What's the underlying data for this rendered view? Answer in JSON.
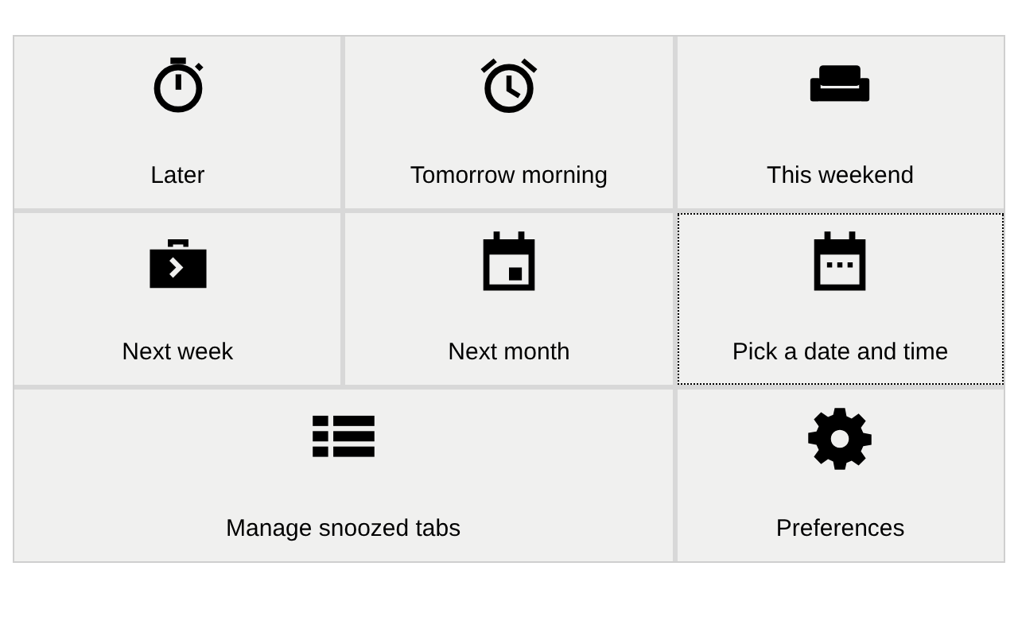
{
  "options": [
    {
      "label": "Later",
      "kind": "stopwatch",
      "focused": false
    },
    {
      "label": "Tomorrow morning",
      "kind": "alarm",
      "focused": false
    },
    {
      "label": "This weekend",
      "kind": "sofa",
      "focused": false
    },
    {
      "label": "Next week",
      "kind": "briefcase",
      "focused": false
    },
    {
      "label": "Next month",
      "kind": "month",
      "focused": false
    },
    {
      "label": "Pick a date and time",
      "kind": "custom",
      "focused": true
    },
    {
      "label": "Manage snoozed tabs",
      "kind": "manage",
      "focused": false
    },
    {
      "label": "Preferences",
      "kind": "settings",
      "focused": false
    }
  ]
}
